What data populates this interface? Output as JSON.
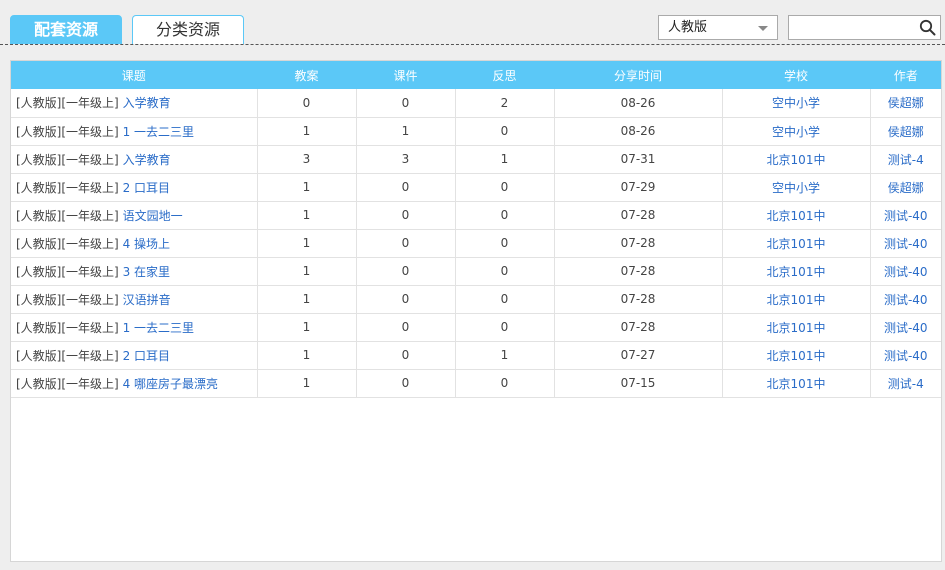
{
  "tabs": {
    "active_label": "配套资源",
    "inactive_label": "分类资源"
  },
  "filter": {
    "edition_selected": "人教版"
  },
  "search": {
    "placeholder": "",
    "value": ""
  },
  "table": {
    "headers": [
      "课题",
      "教案",
      "课件",
      "反思",
      "分享时间",
      "学校",
      "作者"
    ],
    "rows": [
      {
        "prefix": "[人教版][一年级上]",
        "title": "入学教育",
        "jiaoan": "0",
        "kejian": "0",
        "fansi": "2",
        "time": "08-26",
        "school": "空中小学",
        "author": "侯超娜"
      },
      {
        "prefix": "[人教版][一年级上]",
        "title": "1 一去二三里",
        "jiaoan": "1",
        "kejian": "1",
        "fansi": "0",
        "time": "08-26",
        "school": "空中小学",
        "author": "侯超娜"
      },
      {
        "prefix": "[人教版][一年级上]",
        "title": "入学教育",
        "jiaoan": "3",
        "kejian": "3",
        "fansi": "1",
        "time": "07-31",
        "school": "北京101中",
        "author": "测试-4"
      },
      {
        "prefix": "[人教版][一年级上]",
        "title": "2 口耳目",
        "jiaoan": "1",
        "kejian": "0",
        "fansi": "0",
        "time": "07-29",
        "school": "空中小学",
        "author": "侯超娜"
      },
      {
        "prefix": "[人教版][一年级上]",
        "title": "语文园地一",
        "jiaoan": "1",
        "kejian": "0",
        "fansi": "0",
        "time": "07-28",
        "school": "北京101中",
        "author": "测试-40"
      },
      {
        "prefix": "[人教版][一年级上]",
        "title": "4 操场上",
        "jiaoan": "1",
        "kejian": "0",
        "fansi": "0",
        "time": "07-28",
        "school": "北京101中",
        "author": "测试-40"
      },
      {
        "prefix": "[人教版][一年级上]",
        "title": "3 在家里",
        "jiaoan": "1",
        "kejian": "0",
        "fansi": "0",
        "time": "07-28",
        "school": "北京101中",
        "author": "测试-40"
      },
      {
        "prefix": "[人教版][一年级上]",
        "title": "汉语拼音",
        "jiaoan": "1",
        "kejian": "0",
        "fansi": "0",
        "time": "07-28",
        "school": "北京101中",
        "author": "测试-40"
      },
      {
        "prefix": "[人教版][一年级上]",
        "title": "1 一去二三里",
        "jiaoan": "1",
        "kejian": "0",
        "fansi": "0",
        "time": "07-28",
        "school": "北京101中",
        "author": "测试-40"
      },
      {
        "prefix": "[人教版][一年级上]",
        "title": "2 口耳目",
        "jiaoan": "1",
        "kejian": "0",
        "fansi": "1",
        "time": "07-27",
        "school": "北京101中",
        "author": "测试-40"
      },
      {
        "prefix": "[人教版][一年级上]",
        "title": "4 哪座房子最漂亮",
        "jiaoan": "1",
        "kejian": "0",
        "fansi": "0",
        "time": "07-15",
        "school": "北京101中",
        "author": "测试-4"
      }
    ]
  },
  "colors": {
    "accent": "#5bc8f7",
    "link": "#2a6cc8"
  },
  "icons": {
    "search": "search-icon",
    "dropdown": "chevron-down-icon"
  }
}
